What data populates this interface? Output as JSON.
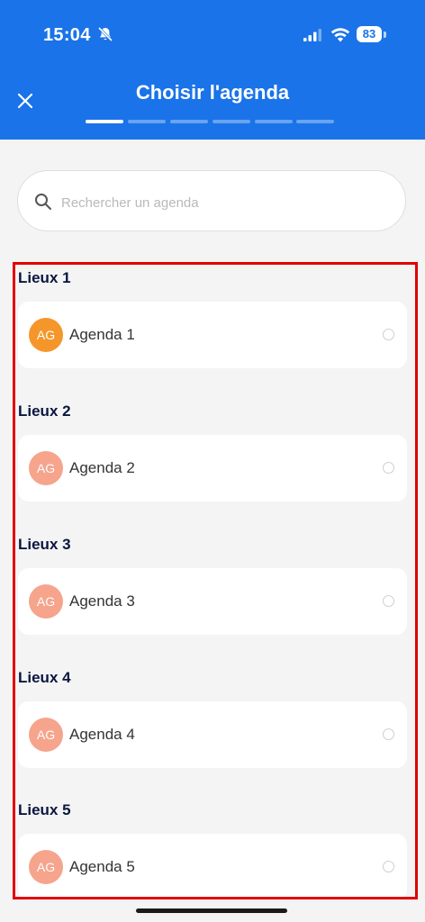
{
  "status_bar": {
    "time": "15:04",
    "battery": "83"
  },
  "header": {
    "title": "Choisir l'agenda",
    "steps_total": 6,
    "steps_active": 1
  },
  "search": {
    "placeholder": "Rechercher un agenda",
    "value": ""
  },
  "groups": [
    {
      "title": "Lieux 1",
      "agenda": {
        "initials": "AG",
        "label": "Agenda 1",
        "avatar_color": "#f5962b"
      }
    },
    {
      "title": "Lieux 2",
      "agenda": {
        "initials": "AG",
        "label": "Agenda 2",
        "avatar_color": "#f6a48c"
      }
    },
    {
      "title": "Lieux 3",
      "agenda": {
        "initials": "AG",
        "label": "Agenda 3",
        "avatar_color": "#f6a48c"
      }
    },
    {
      "title": "Lieux 4",
      "agenda": {
        "initials": "AG",
        "label": "Agenda 4",
        "avatar_color": "#f6a48c"
      }
    },
    {
      "title": "Lieux 5",
      "agenda": {
        "initials": "AG",
        "label": "Agenda 5",
        "avatar_color": "#f6a48c"
      }
    }
  ],
  "colors": {
    "brand": "#1a73e8",
    "highlight": "#e20000",
    "heading": "#0b1640"
  }
}
